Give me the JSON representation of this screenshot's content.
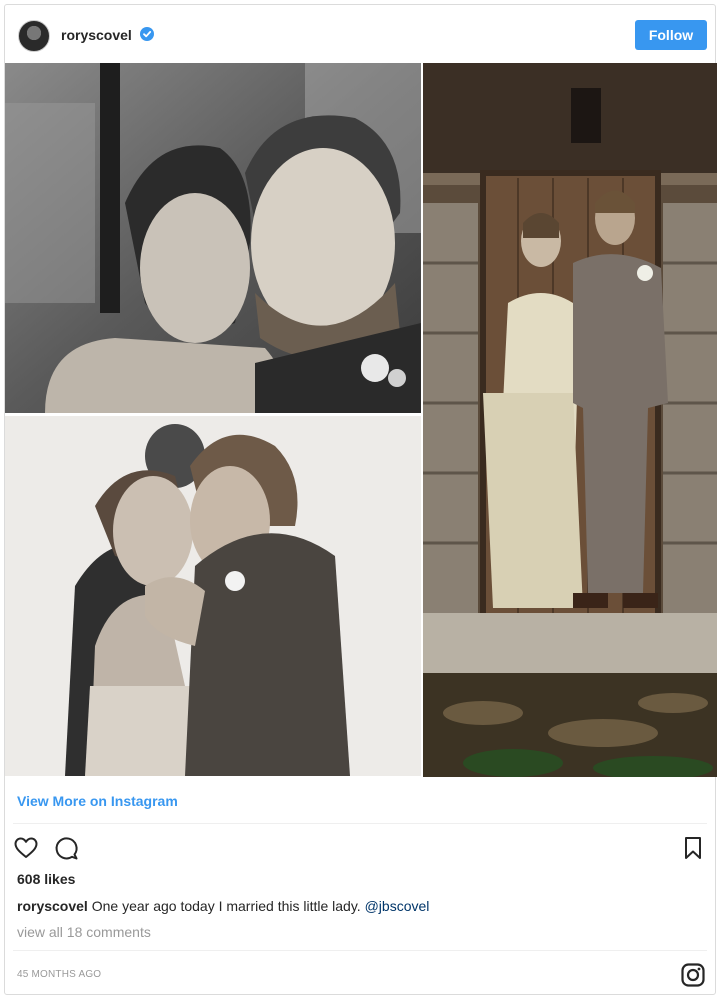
{
  "header": {
    "username": "roryscovel",
    "follow_label": "Follow",
    "verified": true,
    "accent_color": "#3897f0"
  },
  "post": {
    "view_more_label": "View More on Instagram",
    "likes": "608 likes",
    "caption": {
      "user": "roryscovel",
      "text": " One year ago today I married this little lady. ",
      "mention": "@jbscovel"
    },
    "comments_link": "view all 18 comments",
    "timestamp": "45 MONTHS AGO"
  },
  "icons": {
    "like": "heart-icon",
    "comment": "comment-icon",
    "save": "bookmark-icon",
    "brand": "instagram-logo-icon",
    "verified": "verified-badge-icon"
  }
}
